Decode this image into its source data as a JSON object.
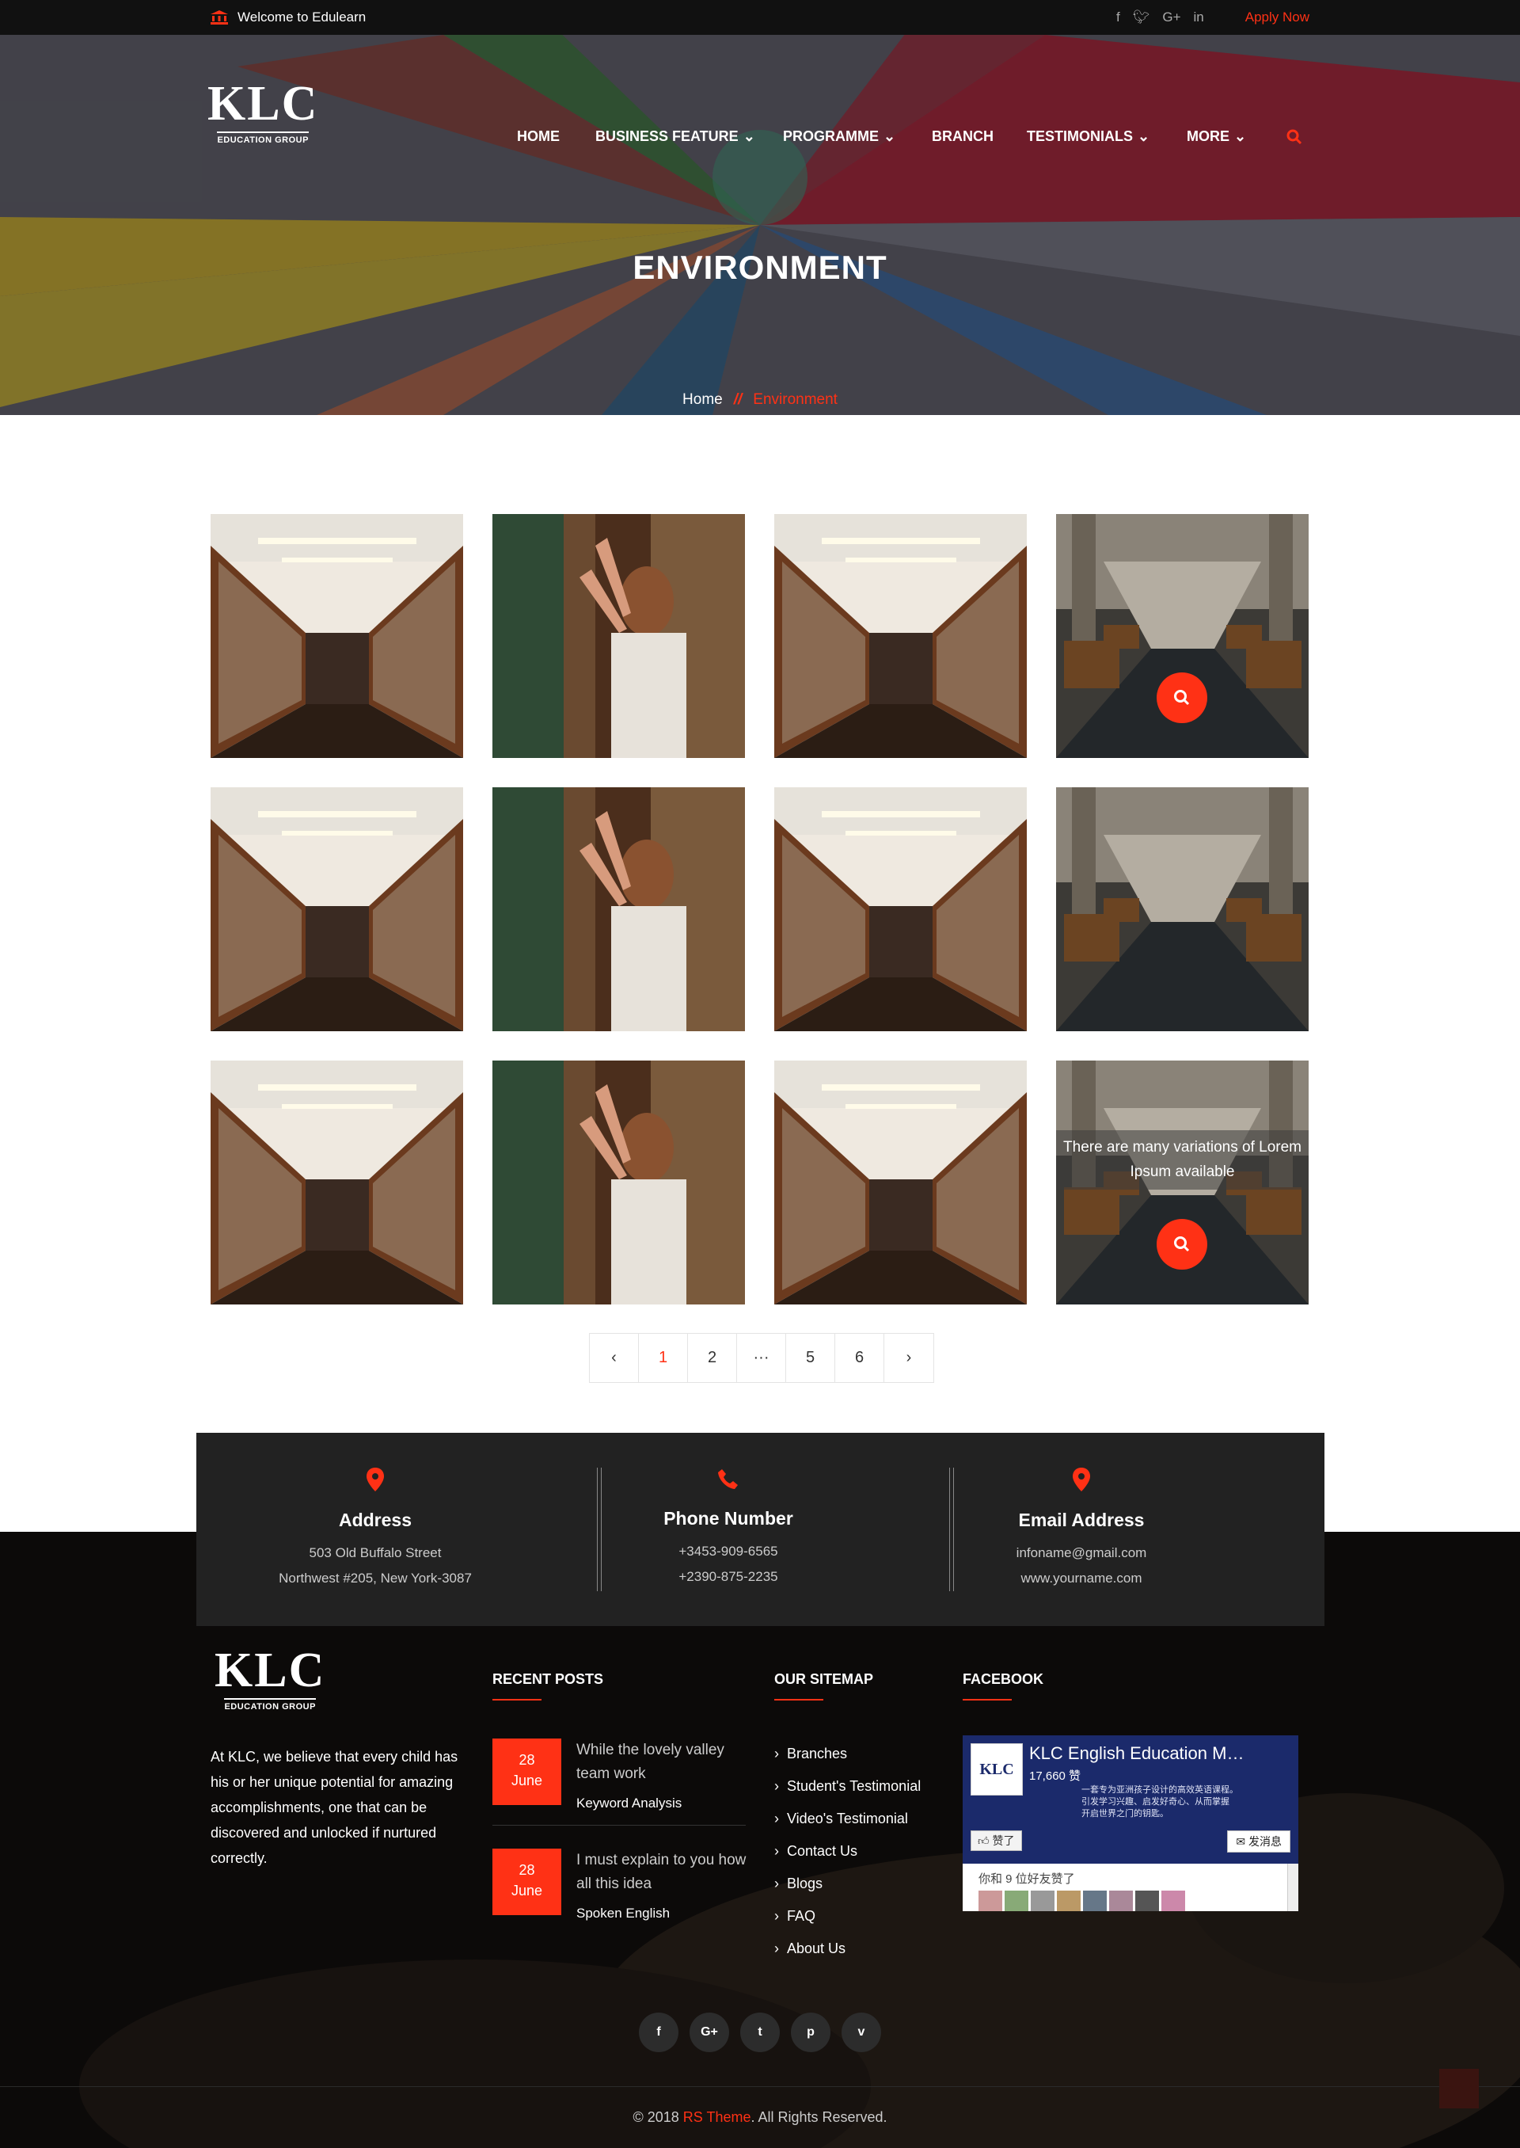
{
  "colors": {
    "accent": "#ff3115",
    "topbar": "#111111",
    "contact_bg": "#222222",
    "footer_bg": "#0c0a09"
  },
  "topbar": {
    "welcome": "Welcome to Edulearn",
    "apply": "Apply Now",
    "social_icons": [
      "facebook-icon",
      "twitter-icon",
      "google-plus-icon",
      "linkedin-icon"
    ]
  },
  "logo": {
    "text": "KLC",
    "reg": "®",
    "subtitle": "EDUCATION GROUP"
  },
  "nav": {
    "items": [
      {
        "label": "HOME"
      },
      {
        "label": "BUSINESS FEATURE"
      },
      {
        "label": "PROGRAMME"
      },
      {
        "label": "BRANCH"
      },
      {
        "label": "TESTIMONIALS"
      },
      {
        "label": "MORE"
      }
    ]
  },
  "page": {
    "title": "ENVIRONMENT",
    "crumb_home": "Home",
    "crumb_sep": "//",
    "crumb_current": "Environment"
  },
  "gallery": {
    "caption": "There are many variations of Lorem Ipsum available"
  },
  "pagination": {
    "prev": "‹",
    "pages": [
      "1",
      "2",
      "···",
      "5",
      "6"
    ],
    "next": "›",
    "active": "1"
  },
  "contact": {
    "address": {
      "title": "Address",
      "line1": "503 Old Buffalo Street",
      "line2": "Northwest #205, New York-3087"
    },
    "phone": {
      "title": "Phone Number",
      "line1": "+3453-909-6565",
      "line2": "+2390-875-2235"
    },
    "email": {
      "title": "Email Address",
      "line1": "infoname@gmail.com",
      "line2": "www.yourname.com"
    }
  },
  "footer": {
    "about": "At KLC, we believe that every child has his or her unique potential for amazing accomplishments, one that can be discovered and unlocked if nurtured correctly.",
    "recent_heading": "RECENT POSTS",
    "sitemap_heading": "OUR SITEMAP",
    "facebook_heading": "FACEBOOK",
    "posts": [
      {
        "day": "28",
        "month": "June",
        "title": "While the lovely valley team work",
        "category": "Keyword Analysis"
      },
      {
        "day": "28",
        "month": "June",
        "title": "I must explain to you how all this idea",
        "category": "Spoken English"
      }
    ],
    "sitemap": [
      "Branches",
      "Student's Testimonial",
      "Video's Testimonial",
      "Contact Us",
      "Blogs",
      "FAQ",
      "About Us"
    ],
    "fb": {
      "name": "KLC English Education M…",
      "likes": "17,660 赞",
      "desc1": "一套专为亚洲孩子设计的高效英语课程。",
      "desc2": "引发学习兴趣、启发好奇心、从而掌握",
      "desc3": "开启世界之门的钥匙。",
      "like_btn": "赞了",
      "msg_btn": "发消息",
      "friends": "你和 9 位好友赞了"
    },
    "social": [
      "f",
      "G+",
      "t",
      "p",
      "v"
    ],
    "copy_pre": "© 2018 ",
    "copy_brand": "RS Theme",
    "copy_post": ". All Rights Reserved."
  }
}
